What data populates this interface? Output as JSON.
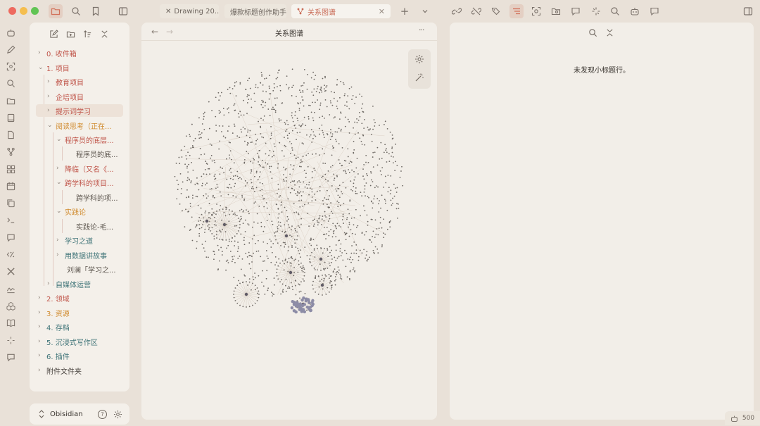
{
  "tabs": [
    {
      "label": "Drawing 20...",
      "icon": "excalidraw-icon"
    },
    {
      "label": "爆款标题创作助手",
      "icon": ""
    },
    {
      "label": "关系图谱",
      "icon": "graph-icon",
      "close": "✕"
    }
  ],
  "explorer": {
    "items": [
      {
        "label": "0. 收件箱",
        "chevron": "›"
      },
      {
        "label": "1. 项目",
        "chevron": "⌄"
      },
      {
        "label": "教育项目",
        "chevron": "›"
      },
      {
        "label": "企培项目",
        "chevron": "›"
      },
      {
        "label": "提示词学习",
        "chevron": "›"
      },
      {
        "label": "阅读思考（正在...",
        "chevron": "⌄"
      },
      {
        "label": "程序员的底层...",
        "chevron": "⌄"
      },
      {
        "label": "程序员的底...",
        "chevron": ""
      },
      {
        "label": "降临（又名《...",
        "chevron": "›"
      },
      {
        "label": "跨学科的项目...",
        "chevron": "⌄"
      },
      {
        "label": "跨学科的项...",
        "chevron": ""
      },
      {
        "label": "实践论",
        "chevron": "⌄"
      },
      {
        "label": "实践论-毛...",
        "chevron": ""
      },
      {
        "label": "学习之道",
        "chevron": "›"
      },
      {
        "label": "用数据讲故事",
        "chevron": "›"
      },
      {
        "label": "刘澜「学习之...",
        "chevron": ""
      },
      {
        "label": "自媒体运营",
        "chevron": "›"
      },
      {
        "label": "2. 领域",
        "chevron": "›"
      },
      {
        "label": "3. 资源",
        "chevron": "›"
      },
      {
        "label": "4. 存档",
        "chevron": "›"
      },
      {
        "label": "5. 沉浸式写作区",
        "chevron": "›"
      },
      {
        "label": "6. 插件",
        "chevron": "›"
      },
      {
        "label": "附件文件夹",
        "chevron": "›"
      }
    ]
  },
  "vault": {
    "name": "Obisidian",
    "help": "?"
  },
  "graph": {
    "title": "关系图谱",
    "menu": "···",
    "back": "←",
    "forward": "→"
  },
  "outline": {
    "empty_message": "未发现小标题行。"
  },
  "status": {
    "word_count": "500"
  }
}
